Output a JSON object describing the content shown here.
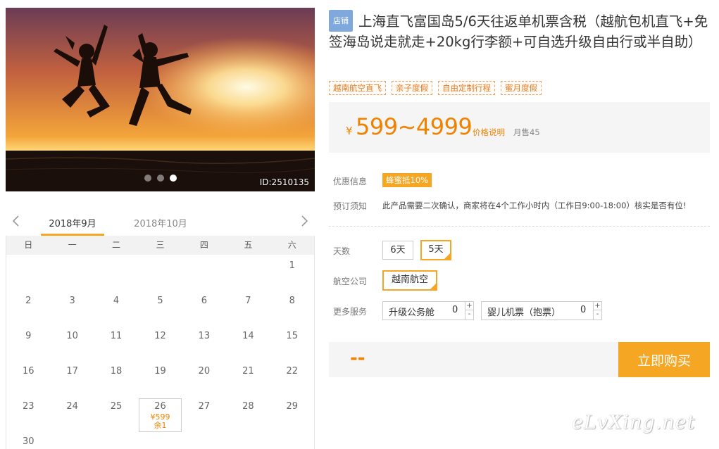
{
  "hero": {
    "image_id": "ID:2510135",
    "slides": 3,
    "active_slide": 3
  },
  "calendar": {
    "months": [
      "2018年9月",
      "2018年10月"
    ],
    "active_month": "2018年9月",
    "weekdays": [
      "日",
      "一",
      "二",
      "三",
      "四",
      "五",
      "六"
    ],
    "days": [
      "",
      "",
      "",
      "",
      "",
      "",
      "1",
      "2",
      "3",
      "4",
      "5",
      "6",
      "7",
      "8",
      "9",
      "10",
      "11",
      "12",
      "13",
      "14",
      "15",
      "16",
      "17",
      "18",
      "19",
      "20",
      "21",
      "22",
      "23",
      "24",
      "25",
      "26",
      "27",
      "28",
      "29",
      "30"
    ],
    "available": {
      "day": "26",
      "price": "¥599",
      "remaining": "余1"
    }
  },
  "product": {
    "shop_badge": "店铺",
    "title": "上海直飞富国岛5/6天往返单机票含税（越航包机直飞+免签海岛说走就走+20kg行李额+可自选升级自由行或半自助）",
    "tags": [
      "越南航空直飞",
      "亲子度假",
      "自由定制行程",
      "蜜月度假"
    ],
    "currency": "¥",
    "price_range": "599~4999",
    "price_note": "价格说明",
    "monthly_sales": "月售45"
  },
  "info": {
    "promo_label": "优惠信息",
    "promo_value": "蜂蜜抵10%",
    "notice_label": "预订须知",
    "notice_value": "此产品需要二次确认，商家将在4个工作小时内（工作日9:00-18:00）核实是否有位!"
  },
  "options": {
    "days_label": "天数",
    "days": [
      "6天",
      "5天"
    ],
    "days_selected": "5天",
    "airline_label": "航空公司",
    "airline": "越南航空",
    "services_label": "更多服务",
    "services": [
      {
        "label": "升级公务舱",
        "qty": "0"
      },
      {
        "label": "婴儿机票（抱票）",
        "qty": "0"
      }
    ],
    "plus": "+",
    "minus": "-"
  },
  "purchase": {
    "total": "--",
    "buy_label": "立即购买"
  },
  "watermark": "eLvXing.net",
  "colors": {
    "accent": "#f5a623",
    "price": "#f08200",
    "badge": "#7fa8dc"
  }
}
